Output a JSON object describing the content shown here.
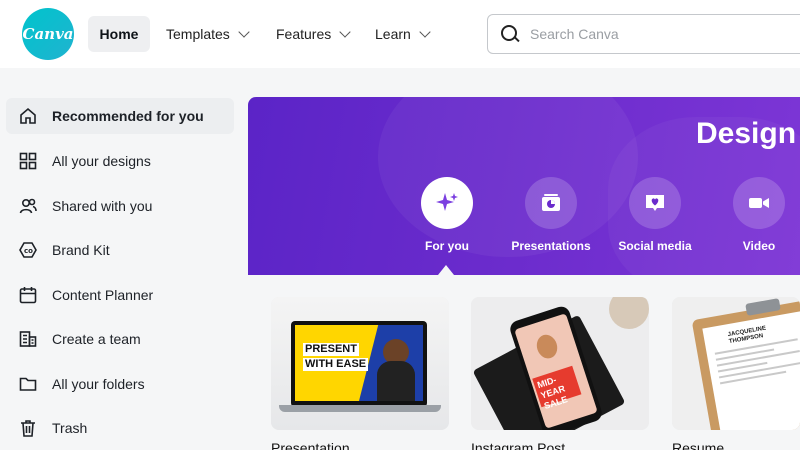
{
  "header": {
    "logo_text": "Canva",
    "nav": [
      {
        "label": "Home"
      },
      {
        "label": "Templates"
      },
      {
        "label": "Features"
      },
      {
        "label": "Learn"
      }
    ],
    "search_placeholder": "Search Canva"
  },
  "sidebar": {
    "items": [
      {
        "label": "Recommended for you",
        "icon": "home-icon"
      },
      {
        "label": "All your designs",
        "icon": "grid-icon"
      },
      {
        "label": "Shared with you",
        "icon": "shared-people-icon"
      },
      {
        "label": "Brand Kit",
        "icon": "brand-kit-icon"
      },
      {
        "label": "Content Planner",
        "icon": "calendar-icon"
      },
      {
        "label": "Create a team",
        "icon": "team-icon"
      },
      {
        "label": "All your folders",
        "icon": "folder-icon"
      },
      {
        "label": "Trash",
        "icon": "trash-icon"
      }
    ]
  },
  "banner": {
    "title": "Design",
    "categories": [
      {
        "label": "For you",
        "icon": "sparkle-icon"
      },
      {
        "label": "Presentations",
        "icon": "presentation-icon"
      },
      {
        "label": "Social media",
        "icon": "heart-icon"
      },
      {
        "label": "Video",
        "icon": "video-icon"
      }
    ]
  },
  "cards": [
    {
      "label": "Presentation",
      "thumb_text": [
        "PRESENT",
        "WITH EASE"
      ]
    },
    {
      "label": "Instagram Post",
      "thumb_text": [
        "MID-YEAR",
        "SALE"
      ]
    },
    {
      "label": "Resume",
      "thumb_text": [
        "JACQUELINE",
        "THOMPSON"
      ]
    }
  ],
  "colors": {
    "brand_teal": "#00c4cc",
    "banner_purple": "#5b24c7",
    "active_bg": "#eceef0"
  }
}
